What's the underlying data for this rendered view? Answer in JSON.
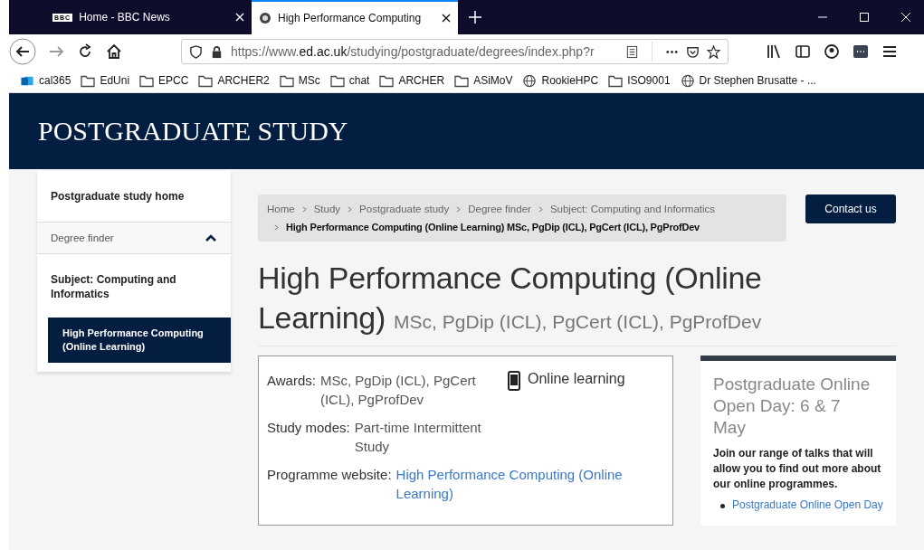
{
  "browser": {
    "tabs": [
      {
        "title": "Home - BBC News",
        "favicon": "BBC",
        "selected": false
      },
      {
        "title": "High Performance Computing",
        "selected": true
      }
    ],
    "url": {
      "prefix": "https://www.",
      "domain": "ed.ac.uk",
      "path": "/studying/postgraduate/degrees/index.php?r"
    },
    "bookmarks": [
      {
        "label": "cal365",
        "kind": "app"
      },
      {
        "label": "EdUni",
        "kind": "folder"
      },
      {
        "label": "EPCC",
        "kind": "folder"
      },
      {
        "label": "ARCHER2",
        "kind": "folder"
      },
      {
        "label": "MSc",
        "kind": "folder"
      },
      {
        "label": "chat",
        "kind": "folder"
      },
      {
        "label": "ARCHER",
        "kind": "folder"
      },
      {
        "label": "ASiMoV",
        "kind": "folder"
      },
      {
        "label": "RookieHPC",
        "kind": "globe"
      },
      {
        "label": "ISO9001",
        "kind": "folder"
      },
      {
        "label": "Dr Stephen Brusatte - ...",
        "kind": "globe"
      }
    ]
  },
  "site_title": "POSTGRADUATE STUDY",
  "sidebar": {
    "items": [
      {
        "label": "Postgraduate study home",
        "kind": "link",
        "selected": false
      },
      {
        "label": "Degree finder",
        "kind": "toggle",
        "expanded": true,
        "selected": false
      },
      {
        "label": "Subject: Computing and Informatics",
        "kind": "subject",
        "selected": false
      },
      {
        "label": "High Performance Computing (Online Learning)",
        "kind": "subject",
        "selected": true
      }
    ]
  },
  "breadcrumb": [
    {
      "label": "Home",
      "current": false
    },
    {
      "label": "Study",
      "current": false
    },
    {
      "label": "Postgraduate study",
      "current": false
    },
    {
      "label": "Degree finder",
      "current": false
    },
    {
      "label": "Subject: Computing and Informatics",
      "current": false
    },
    {
      "label": "High Performance Computing (Online Learning) MSc, PgDip (ICL), PgCert (ICL), PgProfDev",
      "current": true
    }
  ],
  "contact_button": "Contact us",
  "heading": {
    "title": "High Performance Computing (Online Learning)",
    "awards": "MSc, PgDip (ICL), PgCert (ICL), PgProfDev"
  },
  "facts": [
    {
      "label": "Awards:",
      "value": "MSc, PgDip (ICL), PgCert (ICL), PgProfDev",
      "link": false
    },
    {
      "label": "Study modes:",
      "value": "Part-time Intermittent Study",
      "link": false
    },
    {
      "label": "Programme website:",
      "value": "High Performance Computing (Online Learning)",
      "link": true
    }
  ],
  "delivery": "Online learning",
  "promo": {
    "title": "Postgraduate Online Open Day: 6 & 7 May",
    "text": "Join our range of talks that will allow you to find out more about our online programmes.",
    "links": [
      "Postgraduate Online Open Day"
    ]
  }
}
